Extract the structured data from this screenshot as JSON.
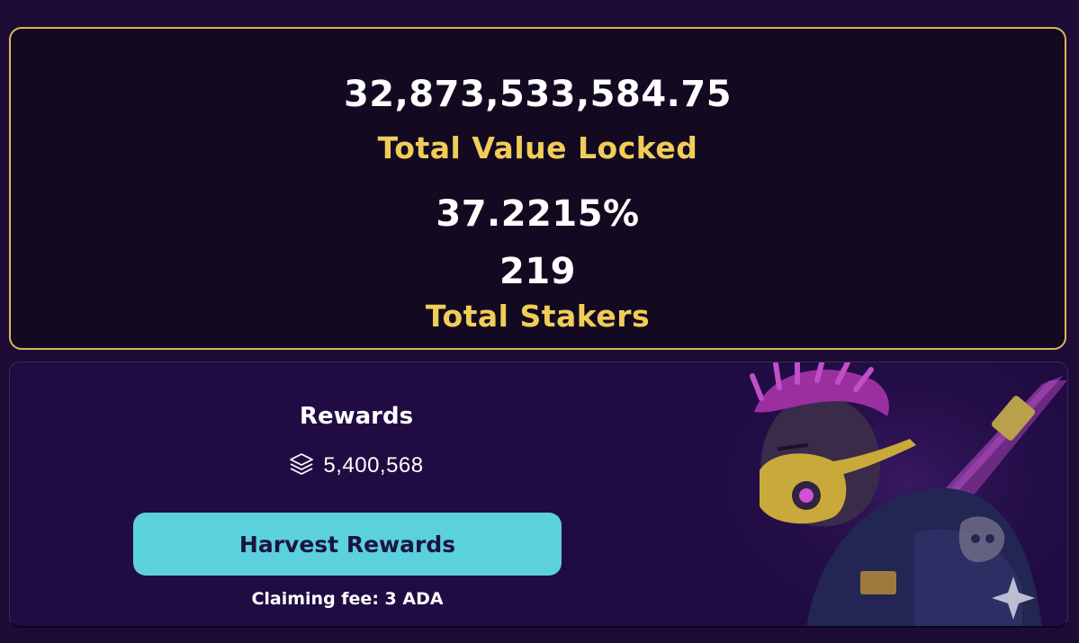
{
  "stats": {
    "total_value_locked": "32,873,533,584.75",
    "total_value_locked_label": "Total Value Locked",
    "apr": "37.2215%",
    "total_stakers": "219",
    "total_stakers_label": "Total Stakers"
  },
  "rewards": {
    "title": "Rewards",
    "icon": "layers-icon",
    "amount": "5,400,568",
    "harvest_button_label": "Harvest Rewards",
    "claiming_fee": "Claiming fee: 3 ADA"
  },
  "colors": {
    "background": "#1d0c35",
    "panel_border": "#d9b65e",
    "label_gold": "#f1cd58",
    "button": "#5ad1dd"
  }
}
